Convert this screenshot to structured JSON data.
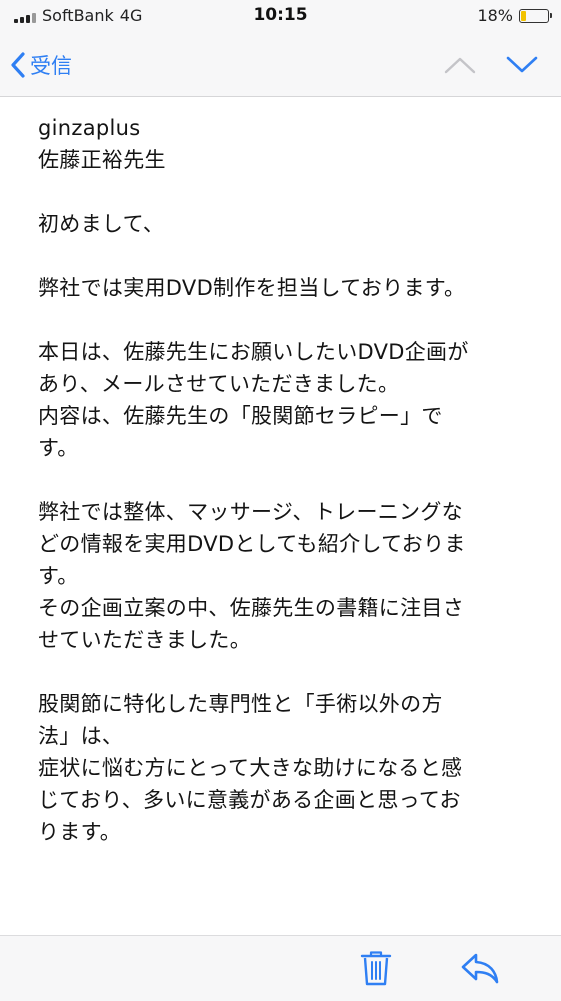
{
  "status_bar": {
    "carrier": "SoftBank",
    "network": "4G",
    "time": "10:15",
    "battery_percent_text": "18%",
    "battery_level": 0.18
  },
  "nav": {
    "back_label": "受信",
    "up_icon": "chevron-up-icon",
    "down_icon": "chevron-down-icon"
  },
  "message": {
    "sender": "ginzaplus",
    "recipient": "佐藤正裕先生",
    "lines": [
      "初めまして、",
      "",
      "弊社では実用DVD制作を担当しております。",
      "",
      "本日は、佐藤先生にお願いしたいDVD企画が",
      "あり、メールさせていただきました。",
      "内容は、佐藤先生の「股関節セラピー」で",
      "す。",
      "",
      "弊社では整体、マッサージ、トレーニングな",
      "どの情報を実用DVDとしても紹介しておりま",
      "す。",
      "その企画立案の中、佐藤先生の書籍に注目さ",
      "せていただきました。",
      "",
      "股関節に特化した専門性と「手術以外の方",
      "法」は、",
      "症状に悩む方にとって大きな助けになると感",
      "じており、多いに意義がある企画と思ってお",
      "ります。"
    ]
  },
  "toolbar": {
    "trash_icon": "trash-icon",
    "reply_icon": "reply-icon"
  },
  "colors": {
    "accent": "#2f7ff3",
    "bar_bg": "#f7f7f8",
    "battery": "#f2c200"
  }
}
